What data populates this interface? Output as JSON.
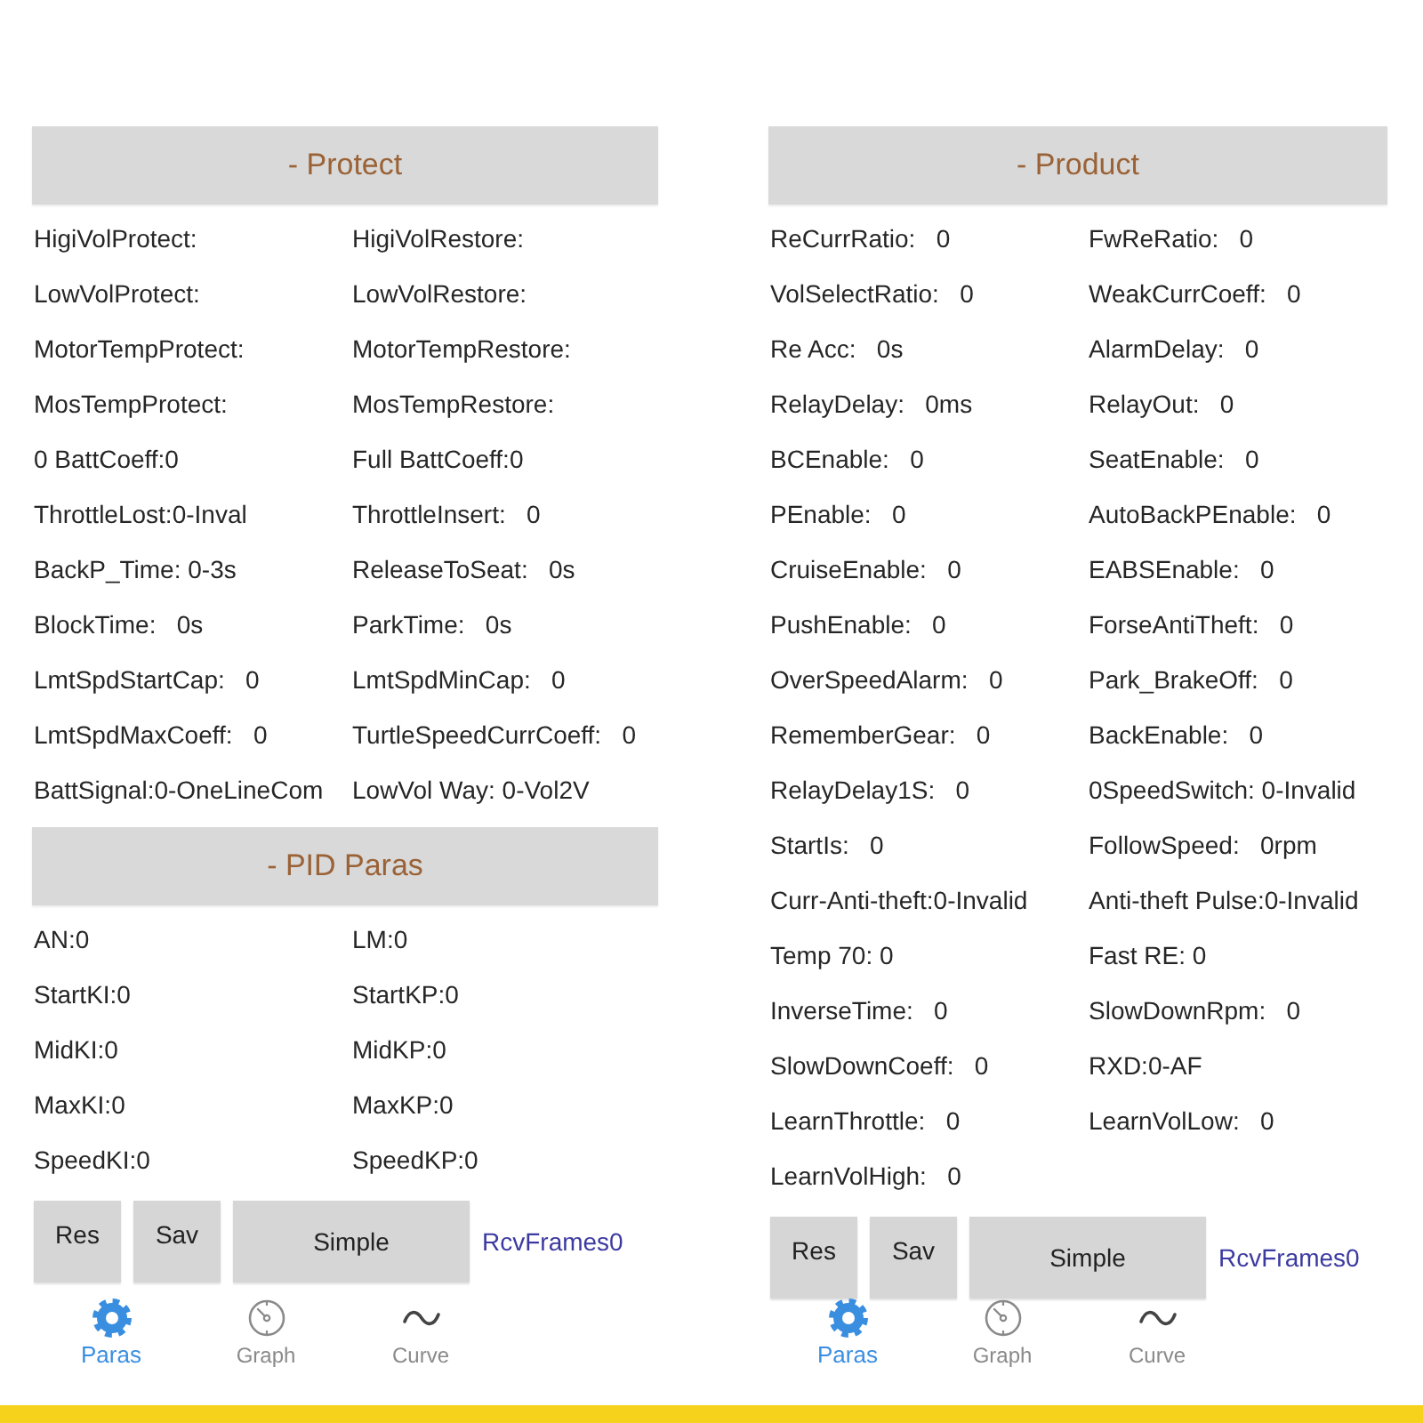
{
  "panels": [
    {
      "sections": [
        {
          "title": "- Protect",
          "fields": [
            "HigiVolProtect:",
            "HigiVolRestore:",
            "LowVolProtect:",
            "LowVolRestore:",
            "MotorTempProtect:",
            "MotorTempRestore:",
            "MosTempProtect:",
            "MosTempRestore:",
            "0 BattCoeff:0",
            "Full BattCoeff:0",
            "ThrottleLost:0-Inval",
            "ThrottleInsert:   0",
            "BackP_Time: 0-3s",
            "ReleaseToSeat:   0s",
            "BlockTime:   0s",
            "ParkTime:   0s",
            "LmtSpdStartCap:   0",
            "LmtSpdMinCap:   0",
            "LmtSpdMaxCoeff:   0",
            "TurtleSpeedCurrCoeff:   0",
            "BattSignal:0-OneLineCom",
            "LowVol Way: 0-Vol2V"
          ]
        },
        {
          "title": "- PID Paras",
          "fields": [
            "AN:0",
            "LM:0",
            "StartKI:0",
            "StartKP:0",
            "MidKI:0",
            "MidKP:0",
            "MaxKI:0",
            "MaxKP:0",
            "SpeedKI:0",
            "SpeedKP:0"
          ]
        }
      ],
      "buttons": [
        {
          "label": "Res",
          "kind": "narrow"
        },
        {
          "label": "Sav",
          "kind": "narrow"
        },
        {
          "label": "Simple",
          "kind": "wide"
        }
      ],
      "frames_label": "RcvFrames0",
      "nav": [
        {
          "label": "Paras",
          "kind": "gear",
          "selected": true
        },
        {
          "label": "Graph",
          "kind": "gauge",
          "selected": false
        },
        {
          "label": "Curve",
          "kind": "wave",
          "selected": false
        }
      ]
    },
    {
      "sections": [
        {
          "title": "- Product",
          "fields": [
            "ReCurrRatio:   0",
            "FwReRatio:   0",
            "VolSelectRatio:   0",
            "WeakCurrCoeff:   0",
            "Re Acc:   0s",
            "AlarmDelay:   0",
            "RelayDelay:   0ms",
            "RelayOut:   0",
            "BCEnable:   0",
            "SeatEnable:   0",
            "PEnable:   0",
            "AutoBackPEnable:   0",
            "CruiseEnable:   0",
            "EABSEnable:   0",
            "PushEnable:   0",
            "ForseAntiTheft:   0",
            "OverSpeedAlarm:   0",
            "Park_BrakeOff:   0",
            "RememberGear:   0",
            "BackEnable:   0",
            "RelayDelay1S:   0",
            "0SpeedSwitch: 0-Invalid",
            "StartIs:   0",
            "FollowSpeed:   0rpm",
            "Curr-Anti-theft:0-Invalid",
            "Anti-theft Pulse:0-Invalid",
            "Temp 70: 0",
            "Fast RE: 0",
            "InverseTime:   0",
            "SlowDownRpm:   0",
            "SlowDownCoeff:   0",
            "RXD:0-AF",
            "LearnThrottle:   0",
            "LearnVolLow:   0",
            "LearnVolHigh:   0"
          ]
        }
      ],
      "buttons": [
        {
          "label": "Res",
          "kind": "narrow"
        },
        {
          "label": "Sav",
          "kind": "narrow"
        },
        {
          "label": "Simple",
          "kind": "wide"
        }
      ],
      "frames_label": "RcvFrames0",
      "nav": [
        {
          "label": "Paras",
          "kind": "gear",
          "selected": true
        },
        {
          "label": "Graph",
          "kind": "gauge",
          "selected": false
        },
        {
          "label": "Curve",
          "kind": "wave",
          "selected": false
        }
      ]
    }
  ]
}
